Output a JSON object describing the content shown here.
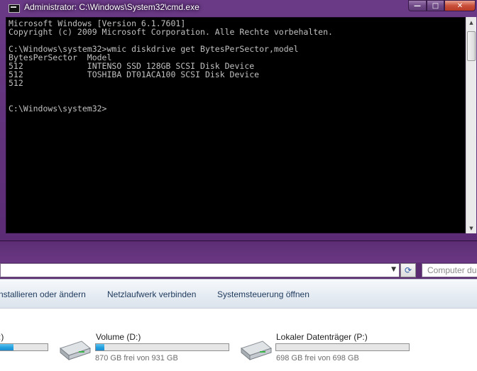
{
  "cmd": {
    "title": "Administrator: C:\\Windows\\System32\\cmd.exe",
    "icon": "cmd-icon",
    "console_lines": [
      "Microsoft Windows [Version 6.1.7601]",
      "Copyright (c) 2009 Microsoft Corporation. Alle Rechte vorbehalten.",
      "",
      "C:\\Windows\\system32>wmic diskdrive get BytesPerSector,model",
      "BytesPerSector  Model",
      "512             INTENSO SSD 128GB SCSI Disk Device",
      "512             TOSHIBA DT01ACA100 SCSI Disk Device",
      "512",
      "",
      "",
      "C:\\Windows\\system32>"
    ],
    "controls": {
      "minimize": "—",
      "maximize": "□",
      "close": "✕"
    }
  },
  "explorer": {
    "search_placeholder": "Computer durchsuchen",
    "toolbar": [
      "nstallieren oder ändern",
      "Netzlaufwerk verbinden",
      "Systemsteuerung öffnen"
    ],
    "drives": [
      {
        "label": ":)",
        "free": "",
        "used_fraction": 0.3
      },
      {
        "label": "Volume (D:)",
        "free": "870 GB frei von 931 GB",
        "used_fraction": 0.0655
      },
      {
        "label": "Lokaler Datenträger (P:)",
        "free": "698 GB frei von 698 GB",
        "used_fraction": 0.0
      }
    ]
  },
  "colors": {
    "console_bg": "#000000",
    "console_text": "#c0c0c0",
    "aero_purple": "#6a3686",
    "usage_fill": "#28a3e0"
  }
}
